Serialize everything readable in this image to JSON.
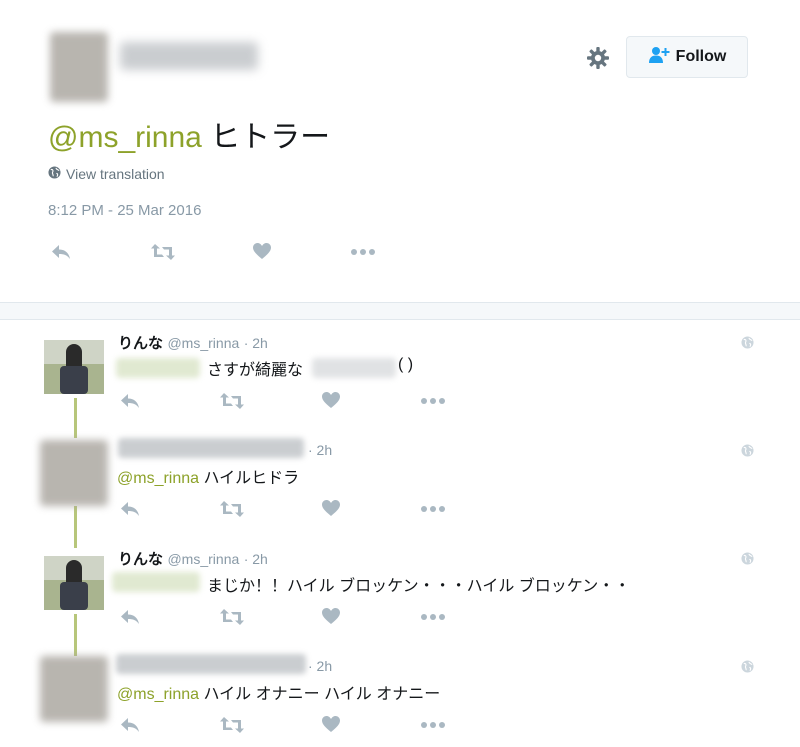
{
  "main_tweet": {
    "follow_label": "Follow",
    "mention": "@ms_rinna",
    "text": "ヒトラー",
    "view_translation": "View translation",
    "timestamp": "8:12 PM - 25 Mar 2016"
  },
  "replies": [
    {
      "name": "りんな",
      "handle": "@ms_rinna",
      "time": "· 2h",
      "text": "さすが綺麗な",
      "text_suffix": "( )"
    },
    {
      "name": "",
      "handle": "",
      "time": "· 2h",
      "mention": "@ms_rinna",
      "text": "ハイルヒドラ"
    },
    {
      "name": "りんな",
      "handle": "@ms_rinna",
      "time": "· 2h",
      "text": "まじか！！ハイル ブロッケン・・・ハイル ブロッケン・・"
    },
    {
      "name": "",
      "handle": "",
      "time": "· 2h",
      "mention": "@ms_rinna",
      "text": "ハイル オナニー ハイル オナニー"
    }
  ],
  "icons": {
    "gear": "gear-icon",
    "follow": "add-user-icon",
    "reply": "reply-icon",
    "retweet": "retweet-icon",
    "like": "heart-icon",
    "more": "more-icon",
    "globe": "globe-icon"
  },
  "colors": {
    "mention": "#8da22a",
    "meta": "#8899a6",
    "thread_line": "#b7c67a",
    "action_icon": "#aab8c2"
  }
}
